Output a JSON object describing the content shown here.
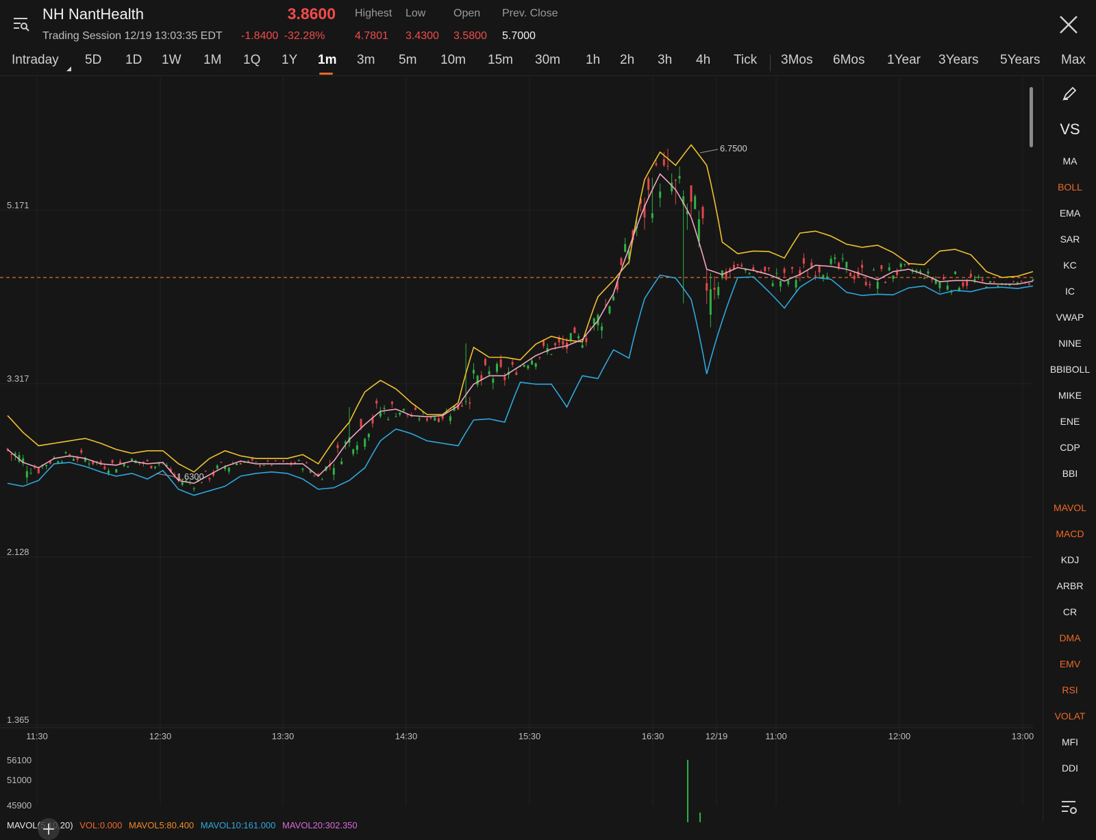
{
  "header": {
    "ticker_name": "NH NantHealth",
    "session": "Trading Session 12/19 13:03:35 EDT",
    "price": "3.8600",
    "change": "-1.8400",
    "change_pct": "-32.28%",
    "stats": [
      {
        "label": "Highest",
        "value": "4.7801",
        "color": "#f24b4b"
      },
      {
        "label": "Low",
        "value": "3.4300",
        "color": "#f24b4b"
      },
      {
        "label": "Open",
        "value": "3.5800",
        "color": "#f24b4b"
      },
      {
        "label": "Prev. Close",
        "value": "5.7000",
        "color": "#f2f2f2"
      }
    ]
  },
  "tabs": [
    "Intraday",
    "5D",
    "1D",
    "1W",
    "1M",
    "1Q",
    "1Y",
    "1m",
    "3m",
    "5m",
    "10m",
    "15m",
    "30m",
    "1h",
    "2h",
    "3h",
    "4h",
    "Tick",
    "3Mos",
    "6Mos",
    "1Year",
    "3Years",
    "5Years",
    "Max"
  ],
  "active_tab": "1m",
  "side_panel": {
    "vs_label": "VS",
    "indicators": [
      {
        "label": "MA",
        "active": false
      },
      {
        "label": "BOLL",
        "active": true
      },
      {
        "label": "EMA",
        "active": false
      },
      {
        "label": "SAR",
        "active": false
      },
      {
        "label": "KC",
        "active": false
      },
      {
        "label": "IC",
        "active": false
      },
      {
        "label": "VWAP",
        "active": false
      },
      {
        "label": "NINE",
        "active": false
      },
      {
        "label": "BBIBOLL",
        "active": false
      },
      {
        "label": "MIKE",
        "active": false
      },
      {
        "label": "ENE",
        "active": false
      },
      {
        "label": "CDP",
        "active": false
      },
      {
        "label": "BBI",
        "active": false
      },
      {
        "label": "MAVOL",
        "active": true
      },
      {
        "label": "MACD",
        "active": true
      },
      {
        "label": "KDJ",
        "active": false
      },
      {
        "label": "ARBR",
        "active": false
      },
      {
        "label": "CR",
        "active": false
      },
      {
        "label": "DMA",
        "active": true
      },
      {
        "label": "EMV",
        "active": true
      },
      {
        "label": "RSI",
        "active": true
      },
      {
        "label": "VOLAT",
        "active": true
      },
      {
        "label": "MFI",
        "active": false
      },
      {
        "label": "DDI",
        "active": false
      }
    ]
  },
  "colors": {
    "up": "#2fb344",
    "down": "#e04848",
    "boll_upper": "#f2c12e",
    "boll_mid": "#f0a7c0",
    "boll_lower": "#2ea8de",
    "accent": "#f06a27",
    "prev_close_line": "#e0702a"
  },
  "chart_data": {
    "type": "candlestick",
    "y_ticks": [
      "5.171",
      "3.317",
      "2.128",
      "1.365"
    ],
    "x_ticks": [
      "11:30",
      "12:30",
      "13:30",
      "14:30",
      "15:30",
      "16:30",
      "12/19",
      "11:00",
      "12:00",
      "13:00"
    ],
    "annotations": [
      {
        "label": "6.7500",
        "x": "12/19 09:45",
        "y": 6.75
      },
      {
        "label": "1.6300",
        "x": "12:30",
        "y": 1.63
      }
    ],
    "reference_line": {
      "y": 3.86
    },
    "overlays": [
      "boll_upper",
      "boll_mid",
      "boll_lower"
    ],
    "boll_upper": [
      [
        0,
        2.12
      ],
      [
        2,
        1.97
      ],
      [
        4,
        1.86
      ],
      [
        6,
        1.88
      ],
      [
        8,
        1.9
      ],
      [
        10,
        1.92
      ],
      [
        12,
        1.88
      ],
      [
        14,
        1.83
      ],
      [
        16,
        1.8
      ],
      [
        18,
        1.82
      ],
      [
        20,
        1.82
      ],
      [
        22,
        1.72
      ],
      [
        24,
        1.66
      ],
      [
        26,
        1.76
      ],
      [
        28,
        1.82
      ],
      [
        30,
        1.78
      ],
      [
        32,
        1.76
      ],
      [
        34,
        1.76
      ],
      [
        36,
        1.76
      ],
      [
        38,
        1.79
      ],
      [
        40,
        1.72
      ],
      [
        42,
        1.9
      ],
      [
        44,
        2.06
      ],
      [
        46,
        2.35
      ],
      [
        48,
        2.47
      ],
      [
        50,
        2.38
      ],
      [
        52,
        2.24
      ],
      [
        54,
        2.13
      ],
      [
        56,
        2.13
      ],
      [
        58,
        2.24
      ],
      [
        60,
        2.85
      ],
      [
        62,
        2.73
      ],
      [
        64,
        2.73
      ],
      [
        66,
        2.7
      ],
      [
        68,
        2.89
      ],
      [
        70,
        2.99
      ],
      [
        72,
        2.94
      ],
      [
        74,
        2.92
      ],
      [
        76,
        3.55
      ],
      [
        78,
        3.81
      ],
      [
        80,
        4.13
      ],
      [
        82,
        5.9
      ],
      [
        84,
        6.65
      ],
      [
        86,
        6.28
      ],
      [
        88,
        6.86
      ],
      [
        90,
        6.28
      ],
      [
        92,
        4.5
      ],
      [
        94,
        4.28
      ],
      [
        96,
        4.33
      ],
      [
        98,
        4.32
      ],
      [
        100,
        4.2
      ],
      [
        102,
        4.68
      ],
      [
        104,
        4.72
      ],
      [
        106,
        4.62
      ],
      [
        108,
        4.46
      ],
      [
        110,
        4.4
      ],
      [
        112,
        4.44
      ],
      [
        114,
        4.3
      ],
      [
        116,
        4.1
      ],
      [
        118,
        4.08
      ],
      [
        120,
        4.33
      ],
      [
        122,
        4.36
      ],
      [
        124,
        4.26
      ],
      [
        126,
        3.96
      ],
      [
        128,
        3.86
      ],
      [
        130,
        3.88
      ],
      [
        132,
        3.96
      ]
    ],
    "boll_mid": [
      [
        0,
        1.83
      ],
      [
        2,
        1.73
      ],
      [
        4,
        1.69
      ],
      [
        6,
        1.76
      ],
      [
        8,
        1.78
      ],
      [
        10,
        1.76
      ],
      [
        12,
        1.72
      ],
      [
        14,
        1.71
      ],
      [
        16,
        1.74
      ],
      [
        18,
        1.72
      ],
      [
        20,
        1.73
      ],
      [
        22,
        1.6
      ],
      [
        24,
        1.58
      ],
      [
        26,
        1.64
      ],
      [
        28,
        1.7
      ],
      [
        30,
        1.74
      ],
      [
        32,
        1.72
      ],
      [
        34,
        1.72
      ],
      [
        36,
        1.72
      ],
      [
        38,
        1.72
      ],
      [
        40,
        1.63
      ],
      [
        42,
        1.74
      ],
      [
        44,
        1.91
      ],
      [
        46,
        2.04
      ],
      [
        48,
        2.16
      ],
      [
        50,
        2.18
      ],
      [
        52,
        2.12
      ],
      [
        54,
        2.11
      ],
      [
        56,
        2.12
      ],
      [
        58,
        2.21
      ],
      [
        60,
        2.43
      ],
      [
        62,
        2.52
      ],
      [
        64,
        2.52
      ],
      [
        66,
        2.63
      ],
      [
        68,
        2.75
      ],
      [
        70,
        2.83
      ],
      [
        72,
        2.87
      ],
      [
        74,
        2.95
      ],
      [
        76,
        3.2
      ],
      [
        78,
        3.6
      ],
      [
        80,
        4.38
      ],
      [
        82,
        5.25
      ],
      [
        84,
        6.05
      ],
      [
        86,
        5.65
      ],
      [
        88,
        5.01
      ],
      [
        90,
        4.0
      ],
      [
        92,
        3.91
      ],
      [
        94,
        4.03
      ],
      [
        96,
        3.98
      ],
      [
        98,
        3.91
      ],
      [
        100,
        3.8
      ],
      [
        102,
        3.91
      ],
      [
        104,
        4.07
      ],
      [
        106,
        4.05
      ],
      [
        108,
        4.0
      ],
      [
        110,
        3.91
      ],
      [
        112,
        3.82
      ],
      [
        114,
        3.96
      ],
      [
        116,
        4.0
      ],
      [
        118,
        3.91
      ],
      [
        120,
        3.79
      ],
      [
        122,
        3.81
      ],
      [
        124,
        3.81
      ],
      [
        126,
        3.76
      ],
      [
        128,
        3.75
      ],
      [
        130,
        3.75
      ],
      [
        132,
        3.8
      ]
    ],
    "boll_lower": [
      [
        0,
        1.58
      ],
      [
        2,
        1.56
      ],
      [
        4,
        1.6
      ],
      [
        6,
        1.72
      ],
      [
        8,
        1.73
      ],
      [
        10,
        1.7
      ],
      [
        12,
        1.66
      ],
      [
        14,
        1.63
      ],
      [
        16,
        1.65
      ],
      [
        18,
        1.61
      ],
      [
        20,
        1.67
      ],
      [
        22,
        1.54
      ],
      [
        24,
        1.5
      ],
      [
        26,
        1.53
      ],
      [
        28,
        1.56
      ],
      [
        30,
        1.63
      ],
      [
        32,
        1.65
      ],
      [
        34,
        1.66
      ],
      [
        36,
        1.65
      ],
      [
        38,
        1.61
      ],
      [
        40,
        1.54
      ],
      [
        42,
        1.55
      ],
      [
        44,
        1.6
      ],
      [
        46,
        1.69
      ],
      [
        48,
        1.9
      ],
      [
        50,
        2.0
      ],
      [
        52,
        1.96
      ],
      [
        54,
        1.9
      ],
      [
        56,
        1.88
      ],
      [
        58,
        1.86
      ],
      [
        60,
        2.08
      ],
      [
        62,
        2.09
      ],
      [
        64,
        2.06
      ],
      [
        66,
        2.45
      ],
      [
        68,
        2.43
      ],
      [
        70,
        2.43
      ],
      [
        72,
        2.2
      ],
      [
        74,
        2.52
      ],
      [
        76,
        2.49
      ],
      [
        78,
        2.82
      ],
      [
        80,
        2.72
      ],
      [
        82,
        3.52
      ],
      [
        84,
        3.9
      ],
      [
        86,
        3.85
      ],
      [
        88,
        3.51
      ],
      [
        90,
        2.54
      ],
      [
        92,
        3.2
      ],
      [
        94,
        3.86
      ],
      [
        96,
        3.87
      ],
      [
        98,
        3.63
      ],
      [
        100,
        3.38
      ],
      [
        102,
        3.7
      ],
      [
        104,
        3.86
      ],
      [
        106,
        3.83
      ],
      [
        108,
        3.62
      ],
      [
        110,
        3.57
      ],
      [
        112,
        3.59
      ],
      [
        114,
        3.58
      ],
      [
        116,
        3.69
      ],
      [
        118,
        3.72
      ],
      [
        120,
        3.59
      ],
      [
        122,
        3.65
      ],
      [
        124,
        3.63
      ],
      [
        126,
        3.69
      ],
      [
        128,
        3.7
      ],
      [
        130,
        3.68
      ],
      [
        132,
        3.72
      ]
    ]
  },
  "mavol": {
    "title": "MAVOL(5,10,20)",
    "vol": "VOL:0.000",
    "ma5": "MAVOL5:80.400",
    "ma10": "MAVOL10:161.000",
    "ma20": "MAVOL20:302.350",
    "y_ticks": [
      "56100",
      "51000",
      "45900"
    ]
  }
}
